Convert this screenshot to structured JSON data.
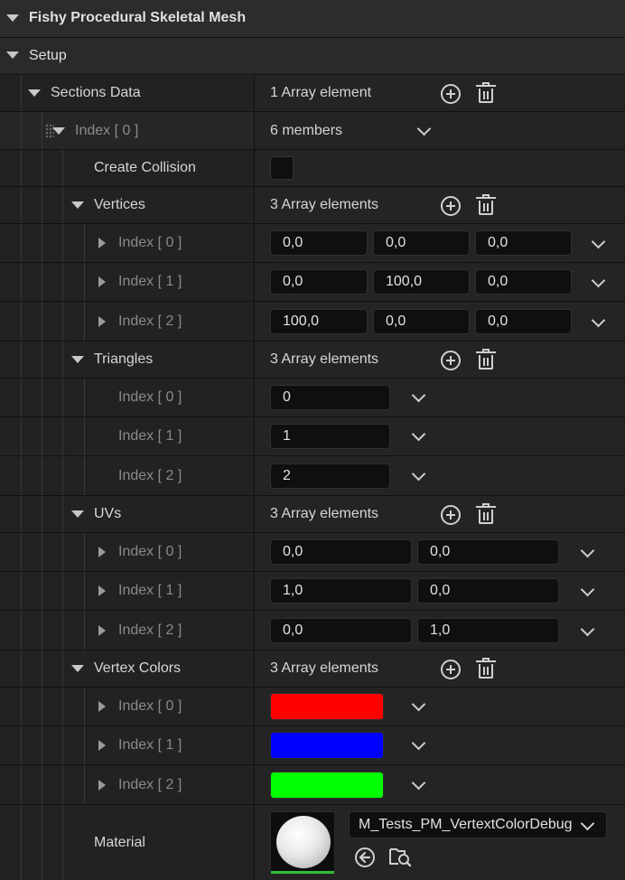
{
  "details": {
    "category_title": "Fishy Procedural Skeletal Mesh",
    "setup_label": "Setup",
    "sections_data": {
      "label": "Sections Data",
      "value": "1 Array element"
    },
    "index0": {
      "label": "Index [ 0 ]",
      "value": "6 members"
    },
    "create_collision": {
      "label": "Create Collision",
      "checked": false
    },
    "vertices": {
      "label": "Vertices",
      "value": "3 Array elements",
      "items": [
        {
          "label": "Index [ 0 ]",
          "x": "0,0",
          "y": "0,0",
          "z": "0,0"
        },
        {
          "label": "Index [ 1 ]",
          "x": "0,0",
          "y": "100,0",
          "z": "0,0"
        },
        {
          "label": "Index [ 2 ]",
          "x": "100,0",
          "y": "0,0",
          "z": "0,0"
        }
      ]
    },
    "triangles": {
      "label": "Triangles",
      "value": "3 Array elements",
      "items": [
        {
          "label": "Index [ 0 ]",
          "value": "0"
        },
        {
          "label": "Index [ 1 ]",
          "value": "1"
        },
        {
          "label": "Index [ 2 ]",
          "value": "2"
        }
      ]
    },
    "uvs": {
      "label": "UVs",
      "value": "3 Array elements",
      "items": [
        {
          "label": "Index [ 0 ]",
          "u": "0,0",
          "v": "0,0"
        },
        {
          "label": "Index [ 1 ]",
          "u": "1,0",
          "v": "0,0"
        },
        {
          "label": "Index [ 2 ]",
          "u": "0,0",
          "v": "1,0"
        }
      ]
    },
    "vertex_colors": {
      "label": "Vertex Colors",
      "value": "3 Array elements",
      "items": [
        {
          "label": "Index [ 0 ]",
          "color": "#ff0000"
        },
        {
          "label": "Index [ 1 ]",
          "color": "#0000ff"
        },
        {
          "label": "Index [ 2 ]",
          "color": "#00ff00"
        }
      ]
    },
    "material": {
      "label": "Material",
      "asset": "M_Tests_PM_VertextColorDebug"
    }
  },
  "icons": {
    "expand": "triangle-down-icon",
    "collapsed": "triangle-right-icon",
    "add": "add-circle-icon",
    "delete": "trash-icon",
    "dropdown": "chevron-down-icon",
    "use_selected": "arrow-left-circle-icon",
    "browse": "folder-search-icon"
  },
  "colors": {
    "background": "#1a1a1a",
    "accent_green": "#2fbf3a"
  }
}
